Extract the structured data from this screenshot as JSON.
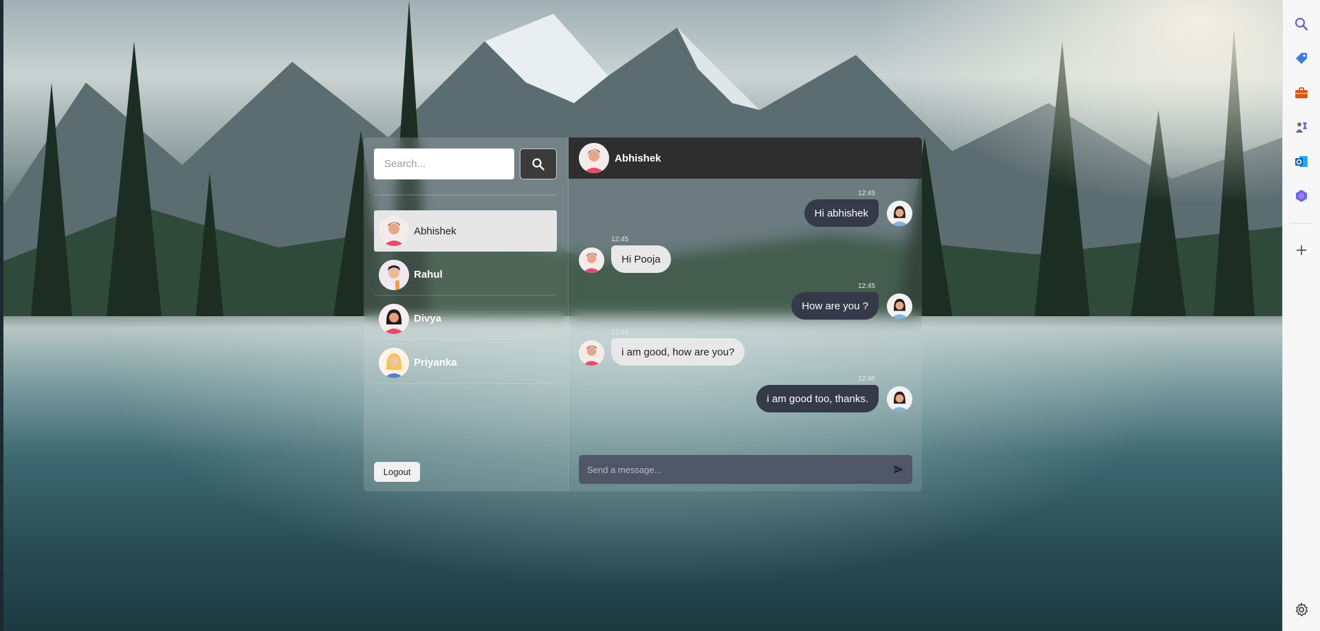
{
  "search": {
    "placeholder": "Search..."
  },
  "contacts": [
    {
      "name": "Abhishek",
      "active": true
    },
    {
      "name": "Rahul",
      "active": false
    },
    {
      "name": "Divya",
      "active": false
    },
    {
      "name": "Priyanka",
      "active": false
    }
  ],
  "logout_label": "Logout",
  "chat": {
    "header_name": "Abhishek",
    "messages": [
      {
        "direction": "out",
        "time": "12:45",
        "text": "Hi abhishek"
      },
      {
        "direction": "in",
        "time": "12:45",
        "text": "Hi Pooja"
      },
      {
        "direction": "out",
        "time": "12:45",
        "text": "How are you ?"
      },
      {
        "direction": "in",
        "time": "12:45",
        "text": "i am good, how are you?"
      },
      {
        "direction": "out",
        "time": "12:45",
        "text": "i am good too, thanks."
      }
    ],
    "composer_placeholder": "Send a message..."
  },
  "edge_sidebar": {
    "icons": [
      "search-icon",
      "tag-icon",
      "toolbox-icon",
      "games-icon",
      "outlook-icon",
      "copilot-icon",
      "add-icon"
    ],
    "bottom_icon": "settings-icon"
  },
  "colors": {
    "header_bg": "#2e2e2e",
    "outgoing_bubble": "#343a48",
    "incoming_bubble": "#e8e8e8",
    "composer_bg": "#4f5666",
    "active_contact_bg": "#e6e6e6"
  }
}
